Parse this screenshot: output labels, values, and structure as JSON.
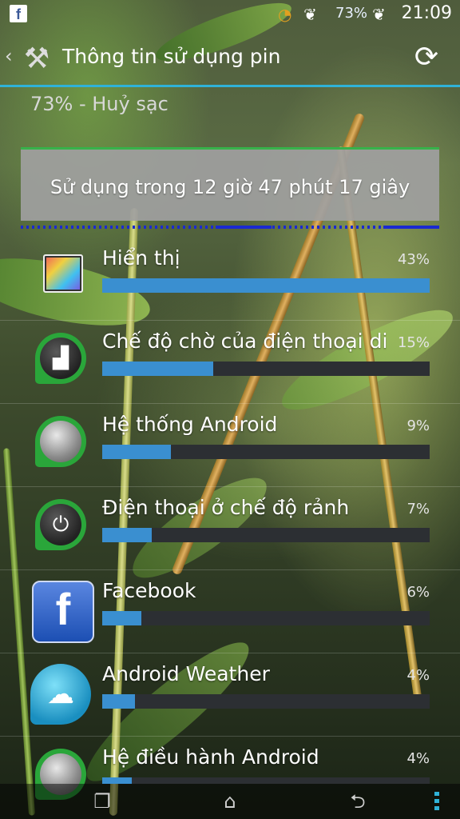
{
  "status_bar": {
    "battery": "73%",
    "time": "21:09",
    "app_icon": "f",
    "icons": [
      "facebook-icon",
      "signal-icon",
      "wifi-icon",
      "wing-left-icon",
      "wing-right-icon"
    ]
  },
  "header": {
    "title": "Thông tin sử dụng pin",
    "back_icon": "chevron-left-icon",
    "tools_icon": "tools-icon",
    "refresh_icon": "refresh-icon"
  },
  "battery_status": "73% - Huỷ sạc",
  "graph": {
    "text": "Sử dụng trong 12 giờ 47 phút 17 giây"
  },
  "usage_items": [
    {
      "name": "Hiển thị",
      "percent_label": "43%",
      "fraction": 1.0,
      "icon": "display-icon"
    },
    {
      "name": "Chế độ chờ của điện thoại di",
      "percent_label": "15%",
      "fraction": 0.34,
      "icon": "cell-standby-icon"
    },
    {
      "name": "Hệ thống Android",
      "percent_label": "9%",
      "fraction": 0.21,
      "icon": "android-system-icon"
    },
    {
      "name": "Điện thoại ở chế độ rảnh",
      "percent_label": "7%",
      "fraction": 0.15,
      "icon": "power-idle-icon"
    },
    {
      "name": "Facebook",
      "percent_label": "6%",
      "fraction": 0.12,
      "icon": "facebook-icon"
    },
    {
      "name": "Android Weather",
      "percent_label": "4%",
      "fraction": 0.1,
      "icon": "weather-icon"
    },
    {
      "name": "Hệ điều hành Android",
      "percent_label": "4%",
      "fraction": 0.09,
      "icon": "android-os-icon"
    }
  ],
  "nav": {
    "recent_icon": "recent-apps-icon",
    "home_icon": "home-icon",
    "back_icon": "back-icon",
    "menu_icon": "menu-icon"
  },
  "colors": {
    "accent": "#2fb2d8",
    "bar_fill": "#3a8fd0",
    "graph_line": "#37b24a",
    "signal": "#1a2ad0"
  }
}
